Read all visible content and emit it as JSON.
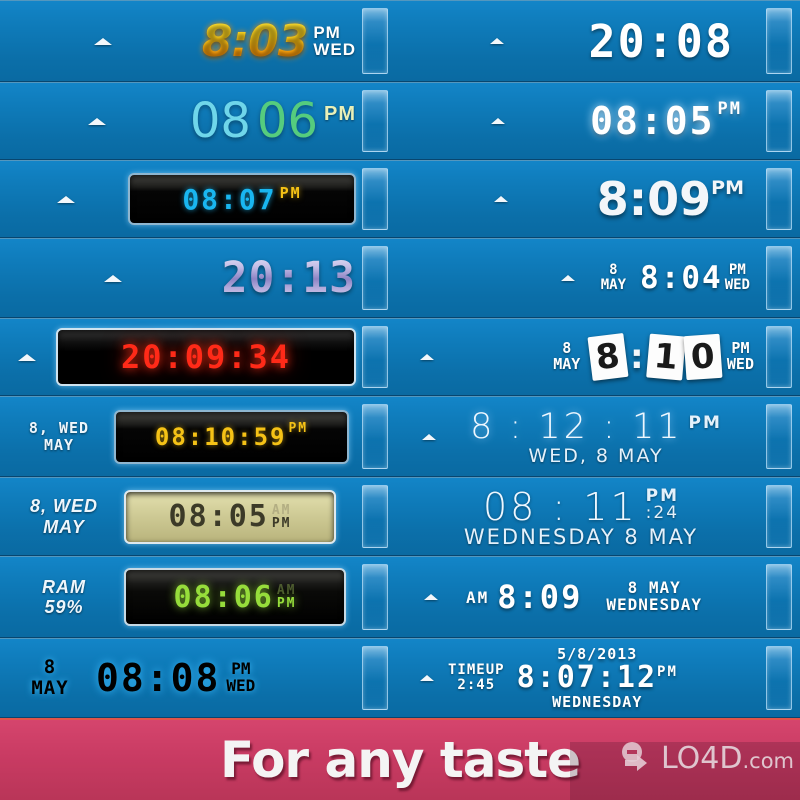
{
  "app": {
    "banner_text": "For any taste",
    "watermark": "LO4D",
    "watermark_suffix": ".com",
    "accent_blue": "#0d7cbd",
    "banner_pink": "#c93b63"
  },
  "left_column": [
    {
      "style": "flame",
      "time": "8:03",
      "ampm": "PM",
      "weekday": "WED"
    },
    {
      "style": "two-tone",
      "hour": "08",
      "minute": "06",
      "ampm": "PM"
    },
    {
      "style": "lcd-black-cyan",
      "time": "08:07",
      "ampm": "PM"
    },
    {
      "style": "chrome-purple",
      "time": "20:13"
    },
    {
      "style": "lcd-red",
      "time": "20:09:34"
    },
    {
      "style": "lcd-yellow",
      "label_line1": "8, WED",
      "label_line2": "MAY",
      "time": "08:10:59",
      "ampm": "PM"
    },
    {
      "style": "lcd-tan",
      "label_line1": "8, WED",
      "label_line2": "MAY",
      "time": "08:05",
      "am_ghost": "AM",
      "pm": "PM"
    },
    {
      "style": "lcd-green",
      "label_line1": "RAM",
      "label_line2": "59%",
      "time": "08:06",
      "am_ghost": "AM",
      "pm": "PM"
    },
    {
      "style": "pixel-blue",
      "label_line1": "8",
      "label_line2": "MAY",
      "time": "08:08",
      "ampm": "PM",
      "weekday": "WED"
    }
  ],
  "right_column": [
    {
      "style": "seg-white-big",
      "time": "20:08"
    },
    {
      "style": "seg-white-glow",
      "time": "08:05",
      "ampm": "PM"
    },
    {
      "style": "fat-white",
      "time": "8:09",
      "ampm": "PM"
    },
    {
      "style": "seg-date-side",
      "day": "8",
      "month": "MAY",
      "time": "8:04",
      "ampm": "PM",
      "weekday": "WED"
    },
    {
      "style": "flip-cards",
      "day": "8",
      "month": "MAY",
      "d1": "8",
      "colon": ":",
      "d2": "1",
      "d3": "0",
      "ampm": "PM",
      "weekday": "WED"
    },
    {
      "style": "thin-glow",
      "time": "8 : 12 : 11",
      "ampm": "PM",
      "subtitle": "WED, 8 MAY"
    },
    {
      "style": "thin-large",
      "time": "08 : 11",
      "ampm": "PM",
      "seconds": ":24",
      "subtitle": "WEDNESDAY 8 MAY"
    },
    {
      "style": "seg-am-left",
      "ampm": "AM",
      "time": "8:09",
      "date_line1": "8 MAY",
      "date_line2": "WEDNESDAY"
    },
    {
      "style": "timeup",
      "label_line1": "TIMEUP",
      "label_line2": "2:45",
      "date": "5/8/2013",
      "time": "8:07:12",
      "ampm": "PM",
      "weekday": "WEDNESDAY"
    }
  ]
}
